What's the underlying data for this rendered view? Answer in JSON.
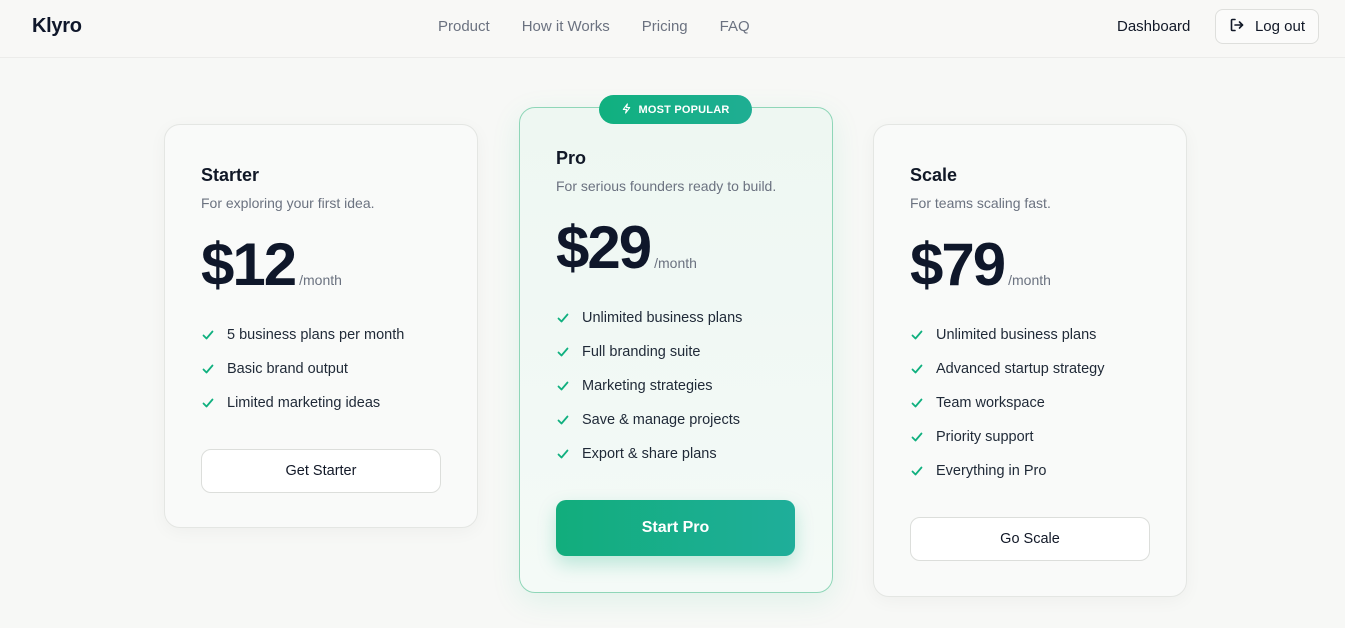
{
  "brand": "Klyro",
  "nav": {
    "links": [
      "Product",
      "How it Works",
      "Pricing",
      "FAQ"
    ],
    "dashboard": "Dashboard",
    "logout": "Log out"
  },
  "colors": {
    "accent": "#10b07f",
    "accent_alt": "#1fae93"
  },
  "plans": [
    {
      "name": "Starter",
      "description": "For exploring your first idea.",
      "price": "$12",
      "period": "/month",
      "features": [
        "5 business plans per month",
        "Basic brand output",
        "Limited marketing ideas"
      ],
      "cta": "Get Starter"
    },
    {
      "name": "Pro",
      "badge": "MOST POPULAR",
      "description": "For serious founders ready to build.",
      "price": "$29",
      "period": "/month",
      "features": [
        "Unlimited business plans",
        "Full branding suite",
        "Marketing strategies",
        "Save & manage projects",
        "Export & share plans"
      ],
      "cta": "Start Pro"
    },
    {
      "name": "Scale",
      "description": "For teams scaling fast.",
      "price": "$79",
      "period": "/month",
      "features": [
        "Unlimited business plans",
        "Advanced startup strategy",
        "Team workspace",
        "Priority support",
        "Everything in Pro"
      ],
      "cta": "Go Scale"
    }
  ]
}
